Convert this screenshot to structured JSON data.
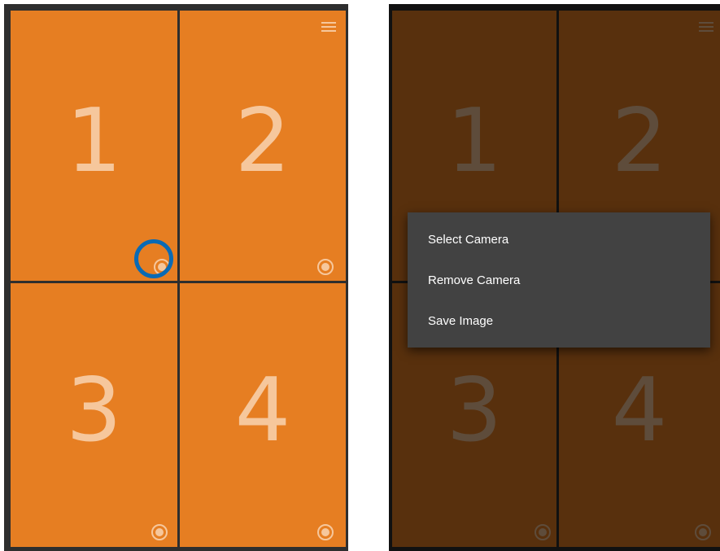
{
  "colors": {
    "tile": "#e67e22",
    "tile_text": "#f6c79c",
    "grid_line": "#2e2e2e",
    "highlight_ring": "#0a6ab4",
    "menu_bg": "#424242",
    "menu_text": "#ffffff"
  },
  "icons": {
    "camera_button": "radio-button-checked-icon",
    "overflow_menu": "hamburger-menu-icon"
  },
  "left_screen": {
    "tiles": [
      {
        "number": "1"
      },
      {
        "number": "2"
      },
      {
        "number": "3"
      },
      {
        "number": "4"
      }
    ],
    "highlighted_control": "tile-1-camera-button"
  },
  "right_screen": {
    "tiles": [
      {
        "number": "1"
      },
      {
        "number": "2"
      },
      {
        "number": "3"
      },
      {
        "number": "4"
      }
    ],
    "context_menu": {
      "items": [
        {
          "label": "Select Camera"
        },
        {
          "label": "Remove Camera"
        },
        {
          "label": "Save Image"
        }
      ]
    }
  }
}
